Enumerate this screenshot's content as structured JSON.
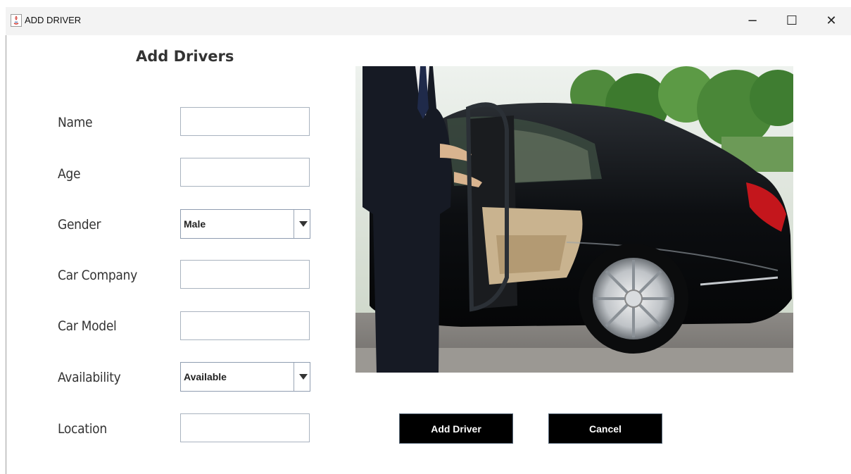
{
  "window": {
    "title": "ADD DRIVER",
    "controls": {
      "minimize": "−",
      "maximize": "☐",
      "close": "✕"
    }
  },
  "form": {
    "heading": "Add Drivers",
    "fields": {
      "name": {
        "label": "Name",
        "value": ""
      },
      "age": {
        "label": "Age",
        "value": ""
      },
      "gender": {
        "label": "Gender",
        "selected": "Male"
      },
      "car_company": {
        "label": "Car Company",
        "value": ""
      },
      "car_model": {
        "label": "Car Model",
        "value": ""
      },
      "availability": {
        "label": "Availability",
        "selected": "Available"
      },
      "location": {
        "label": "Location",
        "value": ""
      }
    }
  },
  "image": {
    "subject": "chauffeur opening door of black sedan"
  },
  "buttons": {
    "add": "Add Driver",
    "cancel": "Cancel"
  },
  "colors": {
    "button_bg": "#000000",
    "button_text": "#ffffff",
    "label_text": "#333333"
  }
}
